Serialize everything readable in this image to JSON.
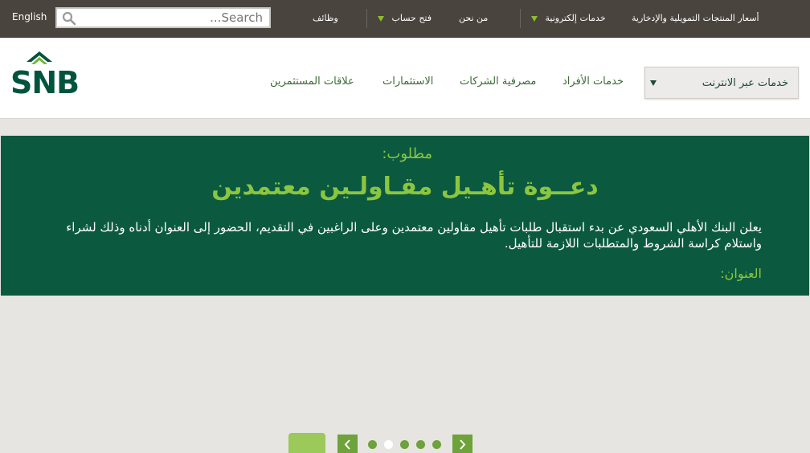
{
  "topbar": {
    "language_link": "English",
    "search_placeholder": "Search...",
    "links": {
      "rates": "أسعار المنتجات التمويلية والإدخارية",
      "eservices": "خدمات إلكترونية",
      "about": "من نحن",
      "open_account": "فتح حساب",
      "jobs": "وظائف"
    }
  },
  "brand": {
    "logo_text": "SNB"
  },
  "nav": {
    "online_services": "خدمات عبر الانترنت",
    "personal": "خدمات الأفراد",
    "corporate": "مصرفية الشركات",
    "investments": "الاستثمارات",
    "investor_relations": "علاقات المستثمرين"
  },
  "banner": {
    "label": "مطلوب:",
    "title": "دعــوة تأهـيل مقـاولـين معتمدين",
    "body": "يعلن البنك الأهلي السعودي عن بدء استقبال طلبات تأهيل مقاولين معتمدين وعلى الراغبين في التقديم، الحضور إلى العنوان أدناه وذلك لشراء واستلام كراسة الشروط والمتطلبات اللازمة للتأهيل.",
    "address_label": "العنوان:"
  },
  "colors": {
    "topbar": "#4a443e",
    "banner": "#0b5a40",
    "accent_green": "#8cc63f",
    "brand_dark": "#00543d"
  },
  "slider": {
    "slides": 5,
    "active_index": 1
  }
}
